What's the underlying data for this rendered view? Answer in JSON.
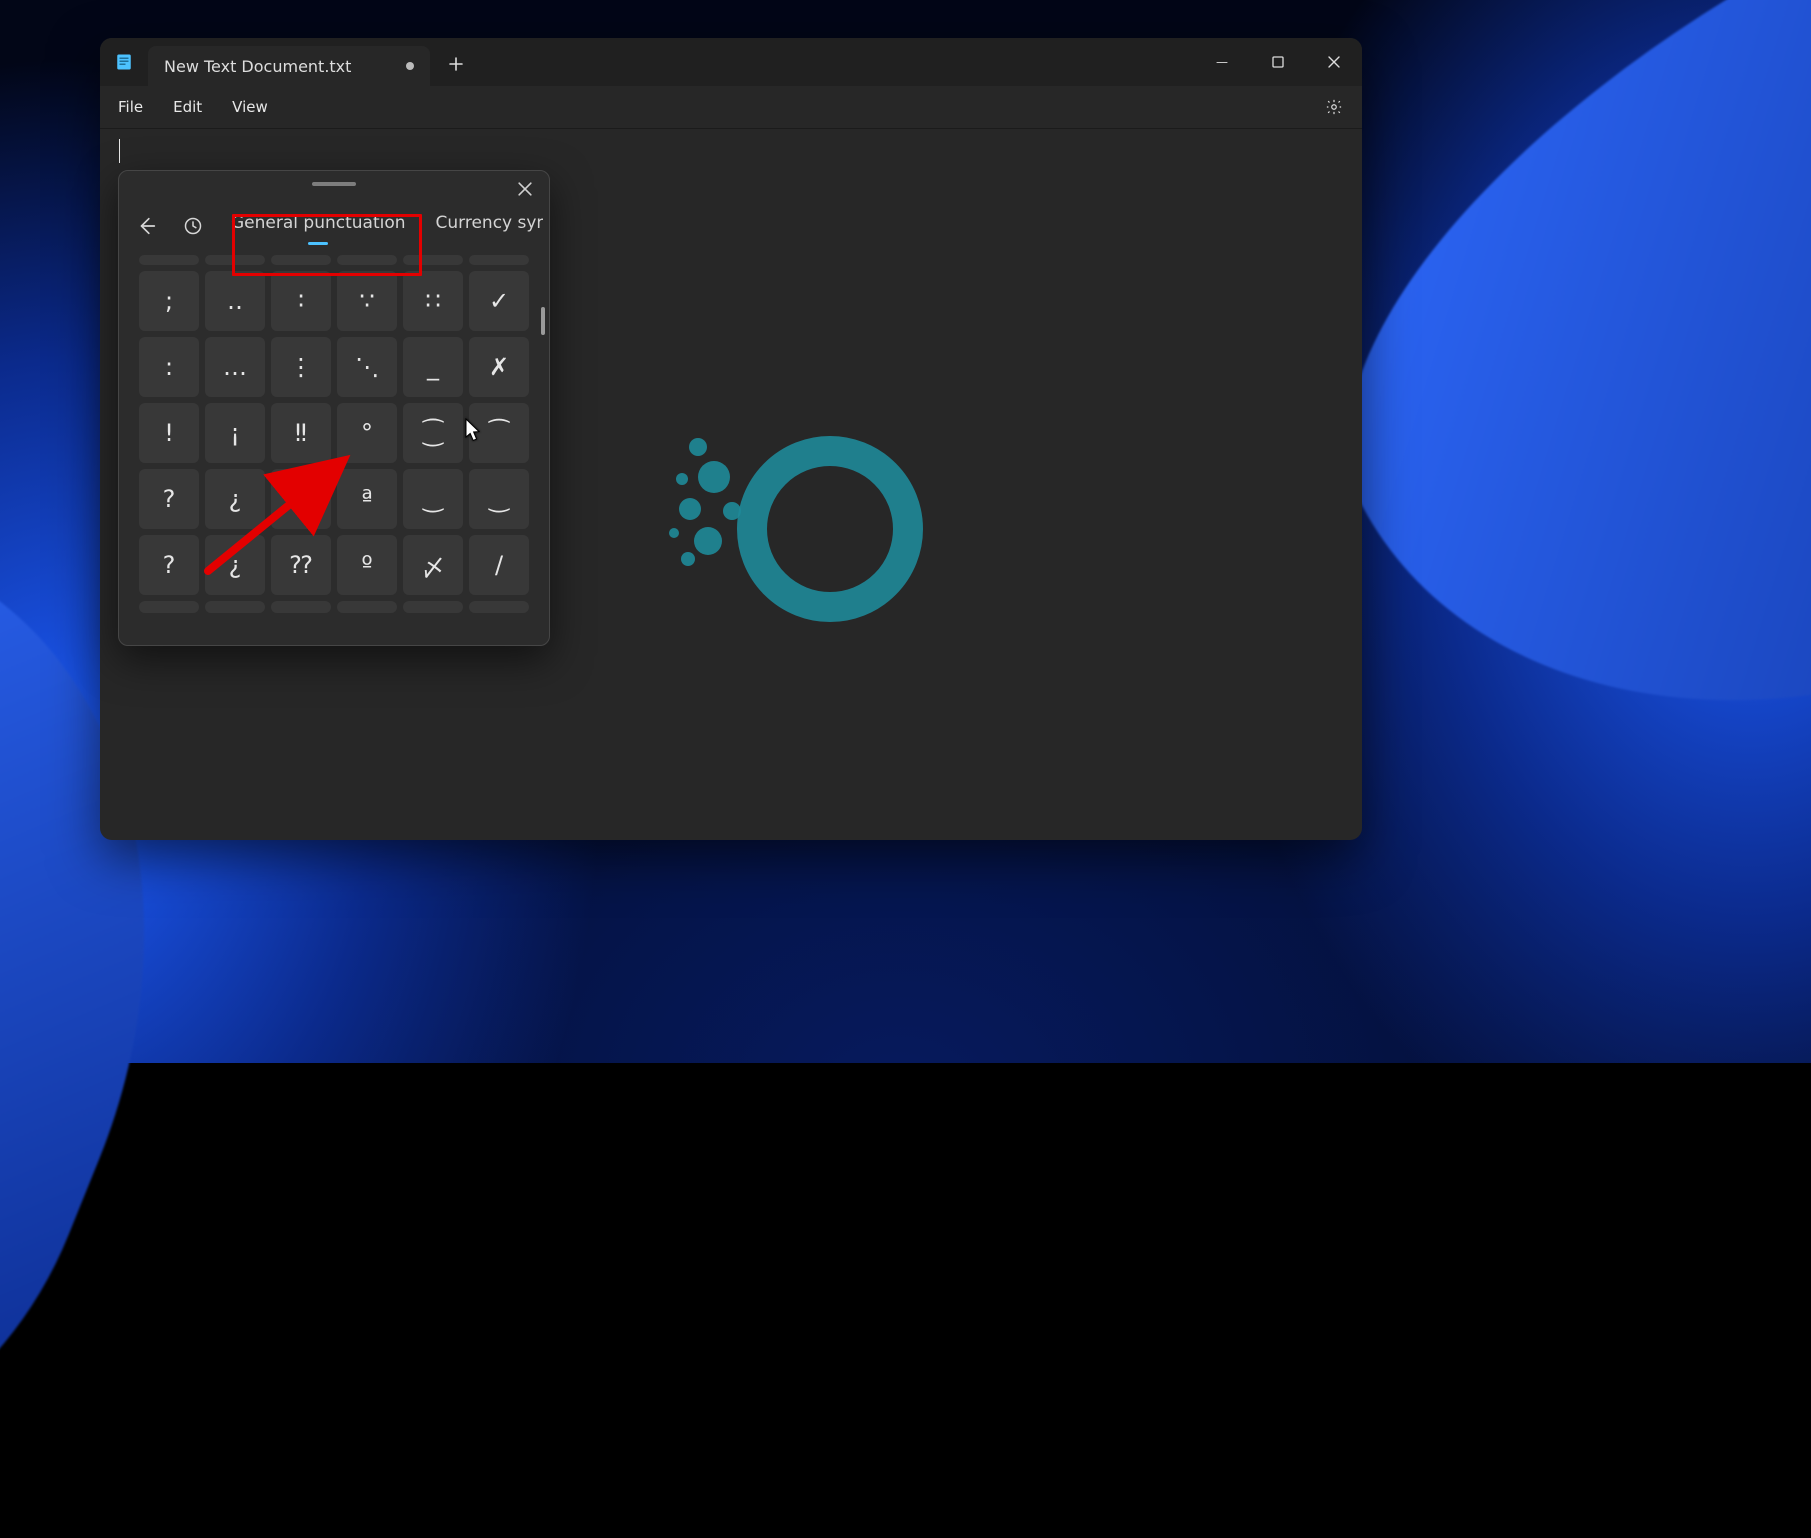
{
  "window": {
    "tab_title": "New Text Document.txt",
    "menus": {
      "file": "File",
      "edit": "Edit",
      "view": "View"
    }
  },
  "panel": {
    "categories": {
      "active": "General punctuation",
      "next": "Currency symb"
    },
    "grid": [
      [
        ";",
        "‥",
        "∶",
        "∵",
        "∷",
        "✓"
      ],
      [
        ":",
        "…",
        "⋮",
        "⋱",
        "_",
        "✗"
      ],
      [
        "!",
        "¡",
        "‼",
        "°",
        "⁐",
        "⁀"
      ],
      [
        "?",
        "¿",
        "⁈",
        "ª",
        "‿",
        "‿"
      ],
      [
        "?",
        "¿",
        "⁇",
        "º",
        "〆",
        "/"
      ]
    ]
  }
}
